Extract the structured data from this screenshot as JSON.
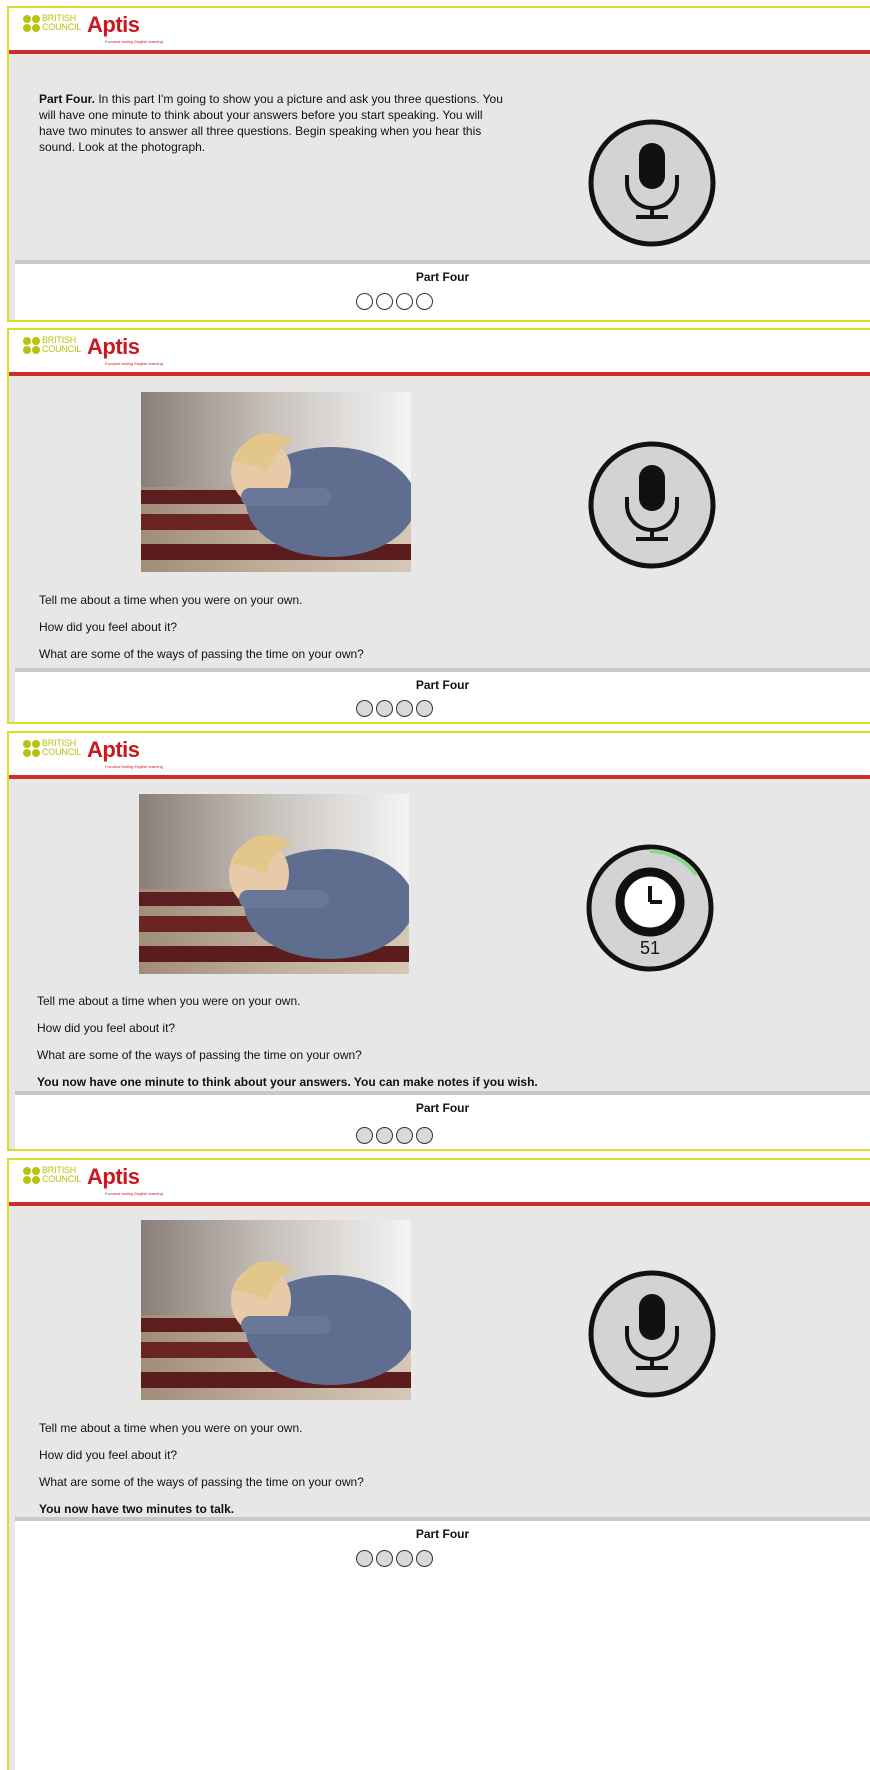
{
  "brand": {
    "council_line1": "BRITISH",
    "council_line2": "COUNCIL",
    "product": "Aptis",
    "tagline": "Focused testing English learning"
  },
  "icons": {
    "microphone": "microphone-icon",
    "timer": "clock-icon"
  },
  "colors": {
    "brand_red": "#d22b2b",
    "border_yellow": "#d7df23",
    "panel_bg": "#e7e7e7",
    "timer_progress": "#8fd58f"
  },
  "screens": [
    {
      "intro_label": "Part Four.",
      "intro_text": " In this part I'm going to show you a picture and ask you three questions. You will have one minute to think about your answers before you start speaking. You will have two minutes to answer all three questions. Begin speaking when you hear this sound. Look at the photograph.",
      "footer_title": "Part Four",
      "progress": "0 of 4"
    },
    {
      "questions": [
        "Tell me about a time when you were on your own.",
        "How did you feel about it?",
        "What are some of the ways of passing the time on your own?"
      ],
      "footer_title": "Part Four"
    },
    {
      "questions": [
        "Tell me about a time when you were on your own.",
        "How did you feel about it?",
        "What are some of the ways of passing the time on your own?"
      ],
      "instruction": "You now have one minute to think about your answers. You can make notes if you wish.",
      "timer_value": "51",
      "timer_fraction_elapsed": 0.15,
      "footer_title": "Part Four"
    },
    {
      "questions": [
        "Tell me about a time when you were on your own.",
        "How did you feel about it?",
        "What are some of the ways of passing the time on your own?"
      ],
      "instruction": "You now have two minutes to talk.",
      "footer_title": "Part Four"
    }
  ]
}
